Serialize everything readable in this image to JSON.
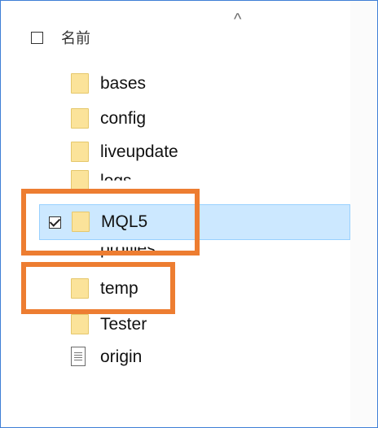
{
  "header": {
    "name_label": "名前",
    "sort_arrow": "^"
  },
  "items": [
    {
      "label": "bases",
      "icon": "folder-icon",
      "selected": false
    },
    {
      "label": "config",
      "icon": "folder-icon",
      "selected": false
    },
    {
      "label": "liveupdate",
      "icon": "folder-icon",
      "selected": false
    },
    {
      "label": "logs",
      "icon": "folder-icon",
      "selected": false
    },
    {
      "label": "MQL5",
      "icon": "folder-icon",
      "selected": true
    },
    {
      "label": "profiles",
      "icon": "folder-icon",
      "selected": false
    },
    {
      "label": "temp",
      "icon": "folder-icon",
      "selected": false
    },
    {
      "label": "Tester",
      "icon": "folder-icon",
      "selected": false
    },
    {
      "label": "origin",
      "icon": "document-icon",
      "selected": false
    }
  ],
  "colors": {
    "highlight": "#ed7d31",
    "selection": "#cce8ff",
    "folder": "#fbe39a"
  }
}
